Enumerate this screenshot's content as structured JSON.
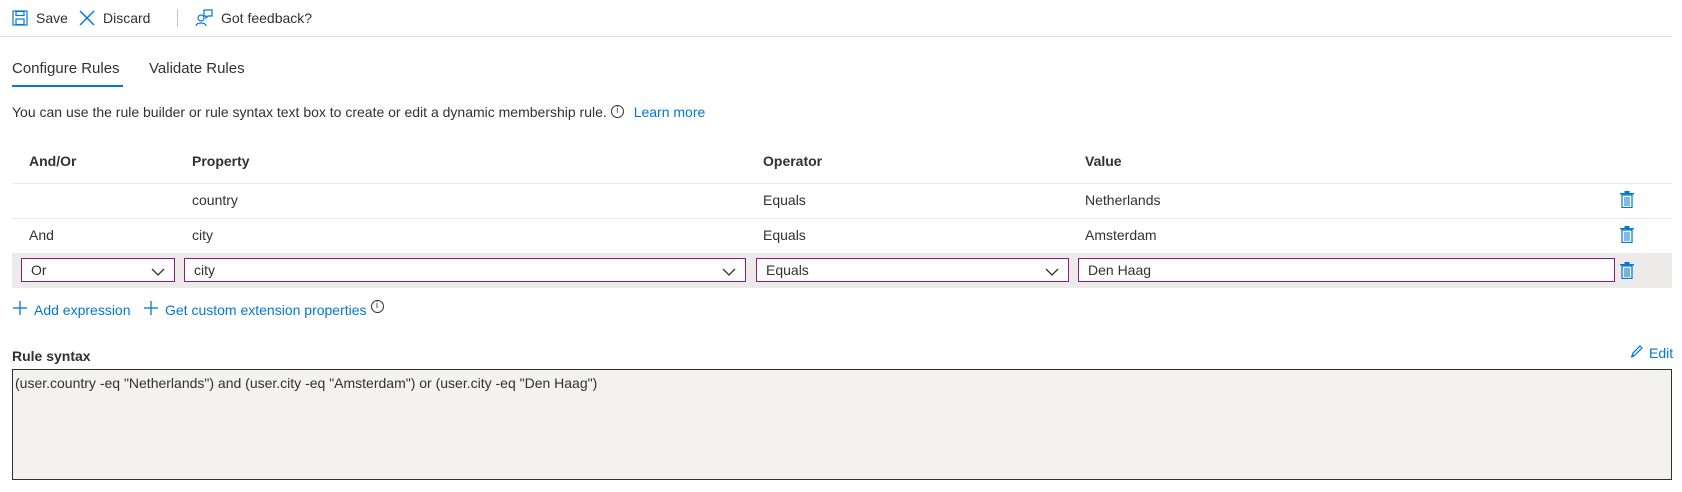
{
  "toolbar": {
    "save_label": "Save",
    "discard_label": "Discard",
    "feedback_label": "Got feedback?"
  },
  "tabs": [
    {
      "label": "Configure Rules",
      "active": true
    },
    {
      "label": "Validate Rules",
      "active": false
    }
  ],
  "description": {
    "text": "You can use the rule builder or rule syntax text box to create or edit a dynamic membership rule.",
    "info_icon": "info-icon",
    "learn_more": "Learn more"
  },
  "table": {
    "headers": [
      "And/Or",
      "Property",
      "Operator",
      "Value"
    ],
    "rows": [
      {
        "andor": "",
        "property": "country",
        "operator": "Equals",
        "value": "Netherlands"
      },
      {
        "andor": "And",
        "property": "city",
        "operator": "Equals",
        "value": "Amsterdam"
      }
    ],
    "edit_row": {
      "andor": "Or",
      "property": "city",
      "operator": "Equals",
      "value": "Den Haag"
    }
  },
  "actions": {
    "add_expression": "Add expression",
    "custom_props": "Get custom extension properties"
  },
  "rule_syntax": {
    "label": "Rule syntax",
    "edit_label": "Edit",
    "text": "(user.country -eq \"Netherlands\") and (user.city -eq \"Amsterdam\") or (user.city -eq \"Den Haag\")"
  },
  "colors": {
    "accent": "#0078d4",
    "edit_border": "#8a1a8a",
    "row_highlight": "#edebe9"
  }
}
